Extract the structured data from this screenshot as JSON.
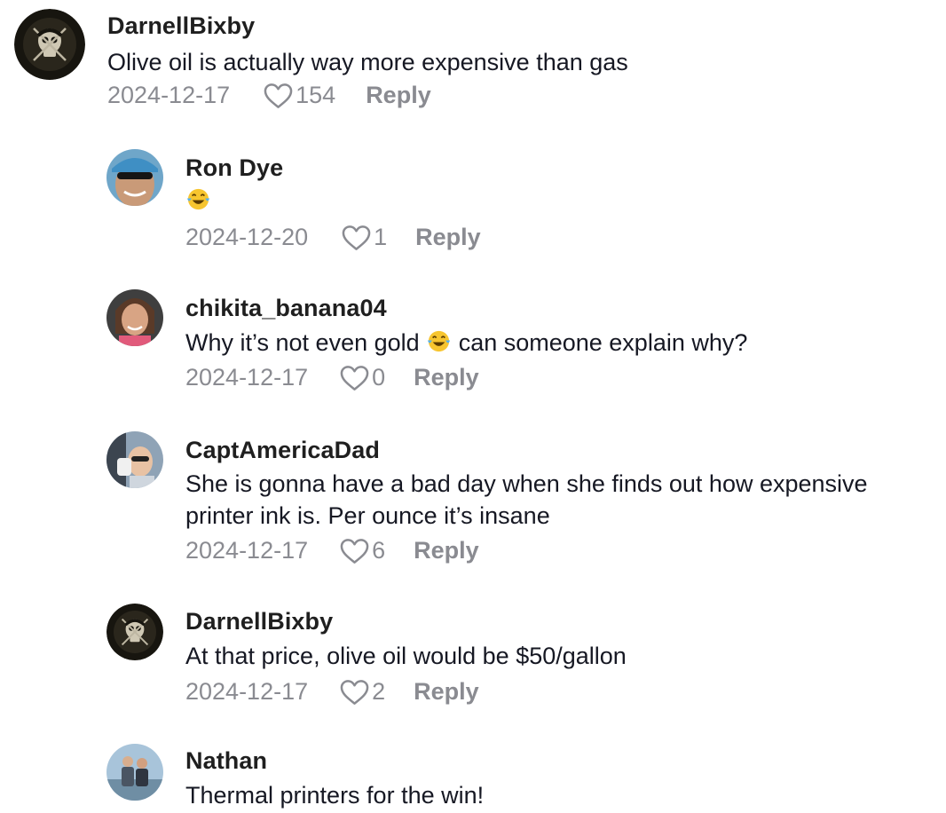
{
  "comments": [
    {
      "username": "DarnellBixby",
      "text": "Olive oil is actually way more expensive than gas",
      "date": "2024-12-17",
      "likes": "154",
      "reply_label": "Reply",
      "avatar": "pirate-skull-avatar"
    },
    {
      "username": "Ron Dye",
      "text_emoji": "face-with-tears-of-joy",
      "date": "2024-12-20",
      "likes": "1",
      "reply_label": "Reply",
      "avatar": "man-sunglasses-cap-avatar"
    },
    {
      "username": "chikita_banana04",
      "text_before": "Why it’s not even gold",
      "text_after": "can someone explain why?",
      "text_emoji": "face-with-tears-of-joy",
      "date": "2024-12-17",
      "likes": "0",
      "reply_label": "Reply",
      "avatar": "woman-smiling-avatar"
    },
    {
      "username": "CaptAmericaDad",
      "text": "She is gonna have a bad day when she finds out how expensive printer ink is. Per ounce it’s insane",
      "date": "2024-12-17",
      "likes": "6",
      "reply_label": "Reply",
      "avatar": "man-selfie-avatar"
    },
    {
      "username": "DarnellBixby",
      "text": "At that price, olive oil would be $50/gallon",
      "date": "2024-12-17",
      "likes": "2",
      "reply_label": "Reply",
      "avatar": "pirate-skull-avatar"
    },
    {
      "username": "Nathan",
      "text": "Thermal printers for the win!",
      "avatar": "two-people-avatar"
    }
  ],
  "colors": {
    "username": "#1f1f1f",
    "text": "#161823",
    "meta": "#8a8b91"
  }
}
